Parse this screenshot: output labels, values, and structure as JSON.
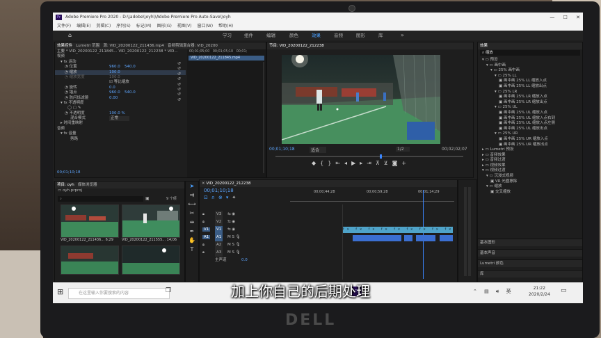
{
  "window": {
    "title": "Adobe Premiere Pro 2020 - D:\\\\adobe\\\\oyh\\\\Adobe Premiere Pro Auto-Save\\\\oyh",
    "logo": "Pr"
  },
  "menu": [
    "文件(F)",
    "编辑(E)",
    "剪辑(C)",
    "序列(S)",
    "标记(M)",
    "图形(G)",
    "视图(V)",
    "窗口(W)",
    "帮助(H)"
  ],
  "workspaces": [
    "学习",
    "组件",
    "编辑",
    "颜色",
    "效果",
    "音频",
    "图形",
    "库"
  ],
  "active_workspace": "效果",
  "effect_controls": {
    "tabs": [
      "效果控件",
      "Lumetri 范围",
      "源: VID_20200122_211436.mp4",
      "音频剪辑混合器: VID_20200"
    ],
    "master_label": "主要 * VID_20200122_211845...",
    "seq_label": "VID_20200122_212238 * VID...",
    "section_video": "视频",
    "motion": "运动",
    "position_label": "位置",
    "position_values": [
      "960.0",
      "540.0"
    ],
    "scale_label": "缩放",
    "scale_value": "100.0",
    "scale_width_label": "缩放宽度",
    "scale_width_value": "100.0",
    "uniform_scale": "等比缩放",
    "rotation_label": "旋转",
    "rotation_value": "0.0",
    "anchor_label": "锚点",
    "anchor_values": [
      "960.0",
      "540.0"
    ],
    "antiflicker_label": "防闪烁滤镜",
    "antiflicker_value": "0.00",
    "opacity": "不透明度",
    "opacity_label": "不透明度",
    "opacity_value": "100.0 %",
    "blend_label": "混合模式",
    "blend_value": "正常",
    "time_remap": "时间重映射",
    "section_audio": "音频",
    "volume": "音量",
    "bypass": "旁路",
    "timecode_left": "00;01;10;18",
    "tl_marks": [
      "00;01;05;00",
      "00;01;05;10",
      "00;01;"
    ],
    "clip_name": "VID_20200122_211845.mp4"
  },
  "program": {
    "tab": "节目: VID_20200122_212238",
    "timecode": "00;01;10;18",
    "fit": "适合",
    "quality": "1/2",
    "duration": "00;02;02;07"
  },
  "project": {
    "tabs": [
      "项目: oyh",
      "媒体浏览器"
    ],
    "file": "oyh.prproj",
    "count": "9 个项",
    "clips": [
      {
        "name": "VID_20200122_211436...",
        "dur": "6;29"
      },
      {
        "name": "VID_20200122_211555...",
        "dur": "14;06"
      }
    ]
  },
  "timeline": {
    "tab": "VID_20200122_212238",
    "timecode": "00;01;10;18",
    "ruler": [
      "00;00;44;28",
      "00;00;59;28",
      "00;01;14;29"
    ],
    "video_tracks": [
      "V3",
      "V2",
      "V1"
    ],
    "audio_tracks": [
      "A1",
      "A2",
      "A3"
    ],
    "master": "主声道",
    "master_value": "0.0"
  },
  "effects": {
    "tab": "效果",
    "search_value": "缩放",
    "items": [
      "预设",
      "画中画",
      "25% 画中画",
      "25% LL",
      "画中画 25% LL 缩放入点",
      "画中画 25% LL 缩放出点",
      "25% LR",
      "画中画 25% LR 缩放入点",
      "画中画 25% LR 缩放出点",
      "25% UL",
      "画中画 25% UL 缩放入点",
      "画中画 25% UL 缩放入点右到",
      "画中画 25% UL 缩放入点左侧",
      "画中画 25% UL 缩放出点",
      "25% UR",
      "画中画 25% UR 缩放入点",
      "画中画 25% UR 缩放出点",
      "Lumetri 预设",
      "音频效果",
      "音频过渡",
      "视频效果",
      "视频过渡",
      "沉浸式视频",
      "VR 光圈擦除",
      "缩放",
      "交叉缩放"
    ],
    "bottom_panels": [
      "基本图形",
      "基本声音",
      "Lumetri 颜色",
      "库"
    ]
  },
  "taskbar": {
    "search_placeholder": "在这里输入你要搜索的内容",
    "time": "21:22",
    "date": "2020/2/24"
  },
  "subtitle": "加上你自己的后期处理",
  "brand": "DELL",
  "colors": {
    "accent_blue": "#4aa0ff",
    "clip_teal": "#4fa3c9",
    "clip_blue": "#3b6fd1",
    "playhead": "#3a86ff"
  }
}
